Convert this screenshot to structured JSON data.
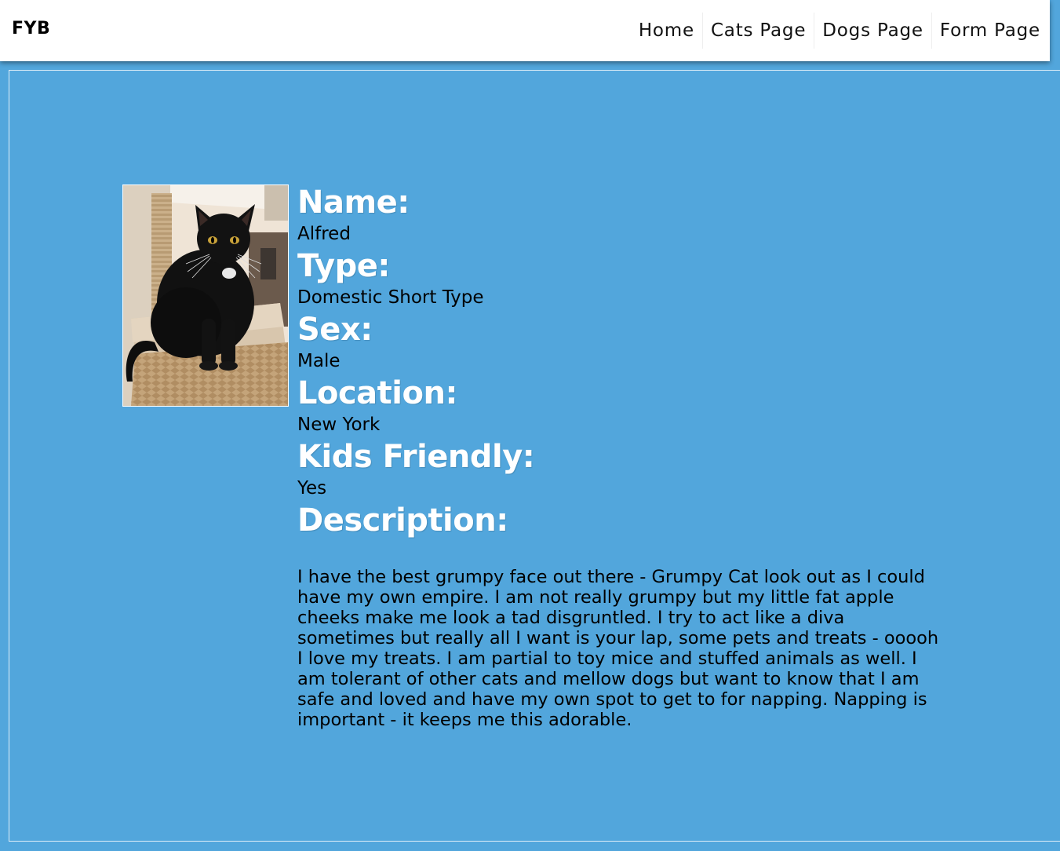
{
  "nav": {
    "brand": "FYB",
    "links": [
      "Home",
      "Cats Page",
      "Dogs Page",
      "Form Page"
    ]
  },
  "pet": {
    "photo_icon": "black-cat-photo",
    "fields": [
      {
        "label": "Name:",
        "value": "Alfred"
      },
      {
        "label": "Type:",
        "value": "Domestic Short Type"
      },
      {
        "label": "Sex:",
        "value": "Male"
      },
      {
        "label": "Location:",
        "value": "New York"
      },
      {
        "label": "Kids Friendly:",
        "value": "Yes"
      }
    ],
    "description_label": "Description:",
    "description": "I have the best grumpy face out there - Grumpy Cat look out as I could have my own empire. I am not really grumpy but my little fat apple cheeks make me look a tad disgruntled. I try to act like a diva sometimes but really all I want is your lap, some pets and treats - ooooh I love my treats. I am partial to toy mice and stuffed animals as well. I am tolerant of other cats and mellow dogs but want to know that I am safe and loved and have my own spot to get to for napping. Napping is important - it keeps me this adorable."
  },
  "colors": {
    "background": "#52a6dc",
    "label": "#ffffff",
    "text": "#000000",
    "navbar": "#ffffff"
  }
}
